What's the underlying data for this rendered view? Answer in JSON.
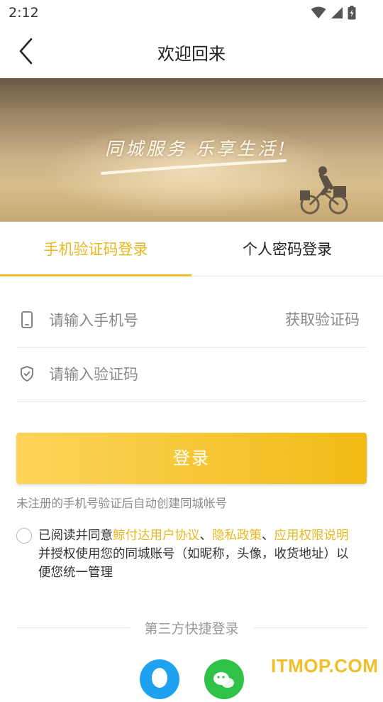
{
  "status_bar": {
    "time": "2:12"
  },
  "header": {
    "title": "欢迎回来"
  },
  "banner": {
    "slogan": "同城服务 乐享生活!"
  },
  "tabs": [
    {
      "label": "手机验证码登录",
      "active": true
    },
    {
      "label": "个人密码登录",
      "active": false
    }
  ],
  "form": {
    "phone": {
      "placeholder": "请输入手机号",
      "value": "",
      "icon": "phone-icon"
    },
    "get_code": "获取验证码",
    "code": {
      "placeholder": "请输入验证码",
      "value": "",
      "icon": "shield-check-icon"
    },
    "login_button": "登录",
    "hint": "未注册的手机号验证后自动创建同城帐号"
  },
  "agreement": {
    "checked": false,
    "prefix": "已阅读并同意",
    "link1": "鲸付达用户协议",
    "sep1": "、",
    "link2": "隐私政策",
    "sep2": "、",
    "link3": "应用权限说明",
    "suffix": "并授权使用您的同城账号（如昵称，头像，收货地址）以便您统一管理"
  },
  "third_party": {
    "label": "第三方快捷登录",
    "providers": [
      "qq",
      "wechat"
    ]
  },
  "watermark": "ITMOP.COM",
  "colors": {
    "accent": "#f0bf27",
    "accent_text": "#e8b820",
    "qq": "#1ea2f0",
    "wechat": "#2fc148"
  }
}
